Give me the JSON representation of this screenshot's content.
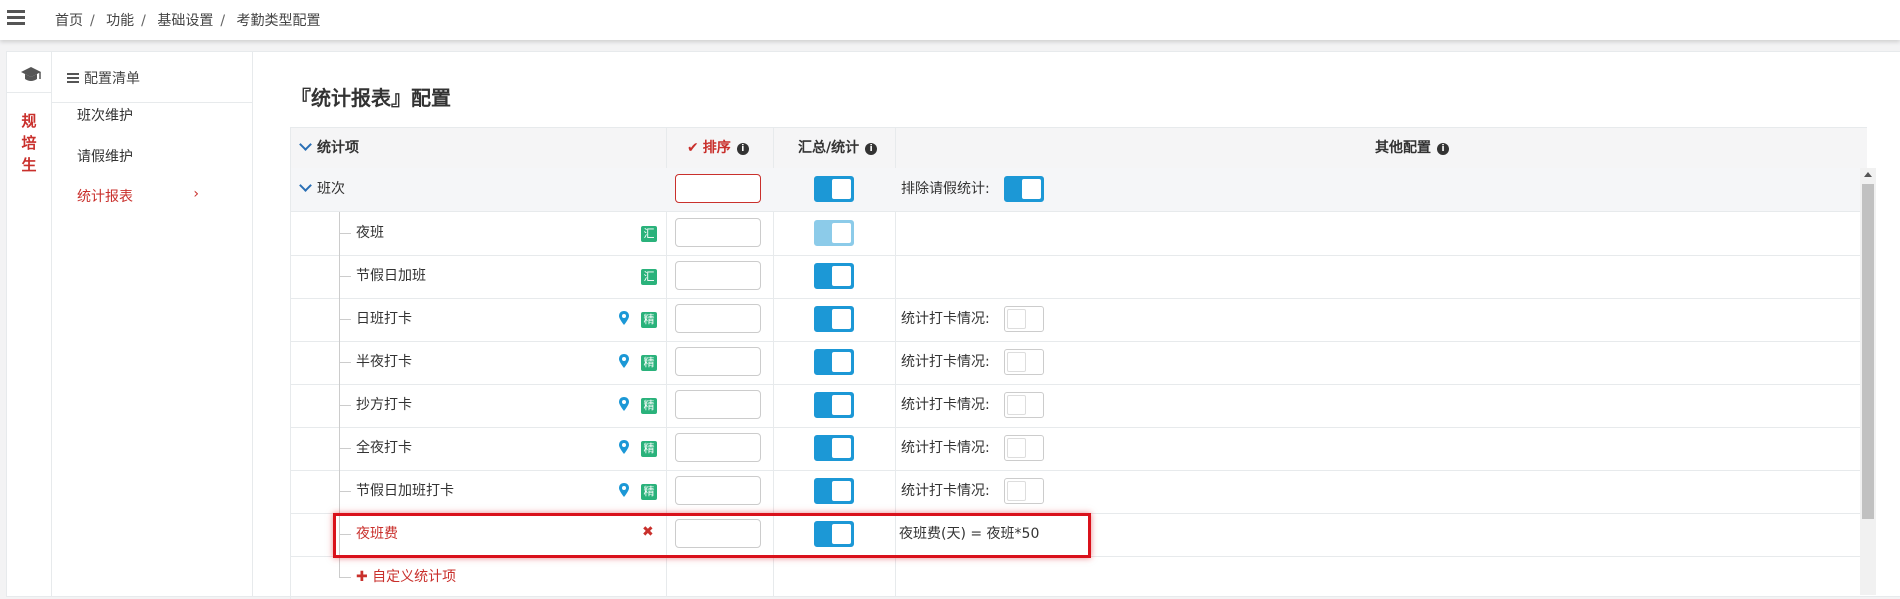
{
  "breadcrumb": [
    "首页",
    "功能",
    "基础设置",
    "考勤类型配置"
  ],
  "rail": {
    "label": "规培生"
  },
  "menu": {
    "title": "配置清单",
    "items": [
      {
        "label": "班次维护",
        "active": false
      },
      {
        "label": "请假维护",
        "active": false
      },
      {
        "label": "统计报表",
        "active": true
      }
    ],
    "chevron": "›"
  },
  "page": {
    "title": "『统计报表』配置"
  },
  "table": {
    "headers": {
      "item": "统计项",
      "sort": "排序",
      "summary": "汇总/统计",
      "other": "其他配置"
    },
    "group": {
      "label": "班次",
      "other_label": "排除请假统计:"
    },
    "rows": [
      {
        "label": "夜班",
        "pin": false,
        "badge": "汇",
        "toggle": "light",
        "other": ""
      },
      {
        "label": "节假日加班",
        "pin": false,
        "badge": "汇",
        "toggle": "on",
        "other": ""
      },
      {
        "label": "日班打卡",
        "pin": true,
        "badge": "精",
        "toggle": "on",
        "other": "统计打卡情况:"
      },
      {
        "label": "半夜打卡",
        "pin": true,
        "badge": "精",
        "toggle": "on",
        "other": "统计打卡情况:"
      },
      {
        "label": "抄方打卡",
        "pin": true,
        "badge": "精",
        "toggle": "on",
        "other": "统计打卡情况:"
      },
      {
        "label": "全夜打卡",
        "pin": true,
        "badge": "精",
        "toggle": "on",
        "other": "统计打卡情况:"
      },
      {
        "label": "节假日加班打卡",
        "pin": true,
        "badge": "精",
        "toggle": "on",
        "other": "统计打卡情况:"
      }
    ],
    "custom_row": {
      "label": "夜班费",
      "formula": "夜班费(天) = 夜班*50",
      "delete_icon": "✖"
    },
    "add_label": "✚ 自定义统计项"
  },
  "colors": {
    "accent": "#c9302c",
    "toggle": "#1c98d6",
    "badge": "#2ab27b",
    "highlight": "#d9111b"
  }
}
